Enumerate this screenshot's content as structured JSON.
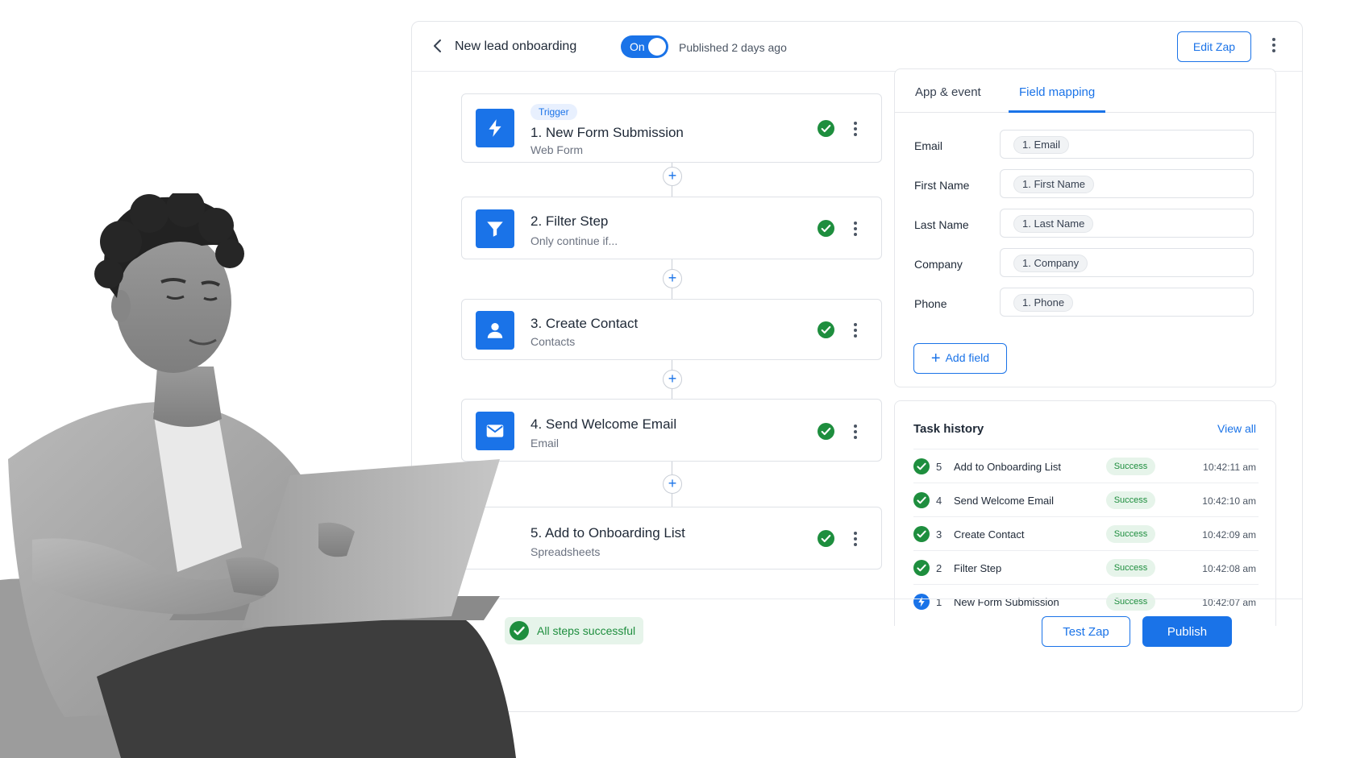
{
  "header": {
    "title": "New lead onboarding",
    "toggle_label": "On",
    "published_text": "Published 2 days ago",
    "edit_label": "Edit Zap"
  },
  "steps": [
    {
      "badge": "Trigger",
      "title": "1. New Form Submission",
      "subtitle": "Web Form",
      "icon": "bolt-icon"
    },
    {
      "title": "2. Filter Step",
      "subtitle": "Only continue if...",
      "icon": "filter-icon"
    },
    {
      "title": "3. Create Contact",
      "subtitle": "Contacts",
      "icon": "person-icon"
    },
    {
      "title": "4. Send Welcome Email",
      "subtitle": "Email",
      "icon": "mail-icon"
    },
    {
      "title": "5. Add to Onboarding List",
      "subtitle": "Spreadsheets",
      "icon": "none"
    }
  ],
  "panel": {
    "tabs": [
      {
        "label": "App & event",
        "active": false
      },
      {
        "label": "Field mapping",
        "active": true
      }
    ],
    "fields": [
      {
        "label": "Email",
        "value": "1. Email"
      },
      {
        "label": "First Name",
        "value": "1. First Name"
      },
      {
        "label": "Last Name",
        "value": "1. Last Name"
      },
      {
        "label": "Company",
        "value": "1. Company"
      },
      {
        "label": "Phone",
        "value": "1. Phone"
      }
    ],
    "add_field_label": "Add field"
  },
  "history": {
    "title": "Task history",
    "view_all": "View all",
    "rows": [
      {
        "num": "5",
        "name": "Add to Onboarding List",
        "status": "Success",
        "time": "10:42:11 am",
        "icon": "check-circle-icon"
      },
      {
        "num": "4",
        "name": "Send Welcome Email",
        "status": "Success",
        "time": "10:42:10 am",
        "icon": "check-circle-icon"
      },
      {
        "num": "3",
        "name": "Create Contact",
        "status": "Success",
        "time": "10:42:09 am",
        "icon": "check-circle-icon"
      },
      {
        "num": "2",
        "name": "Filter Step",
        "status": "Success",
        "time": "10:42:08 am",
        "icon": "check-circle-icon"
      },
      {
        "num": "1",
        "name": "New Form Submission",
        "status": "Success",
        "time": "10:42:07 am",
        "icon": "bolt-circle-icon"
      }
    ]
  },
  "footer": {
    "status_text": "All steps successful",
    "test_label": "Test Zap",
    "publish_label": "Publish"
  },
  "colors": {
    "accent": "#1a73e8",
    "success": "#1e8e3e",
    "success_bg": "#e6f4ea"
  }
}
